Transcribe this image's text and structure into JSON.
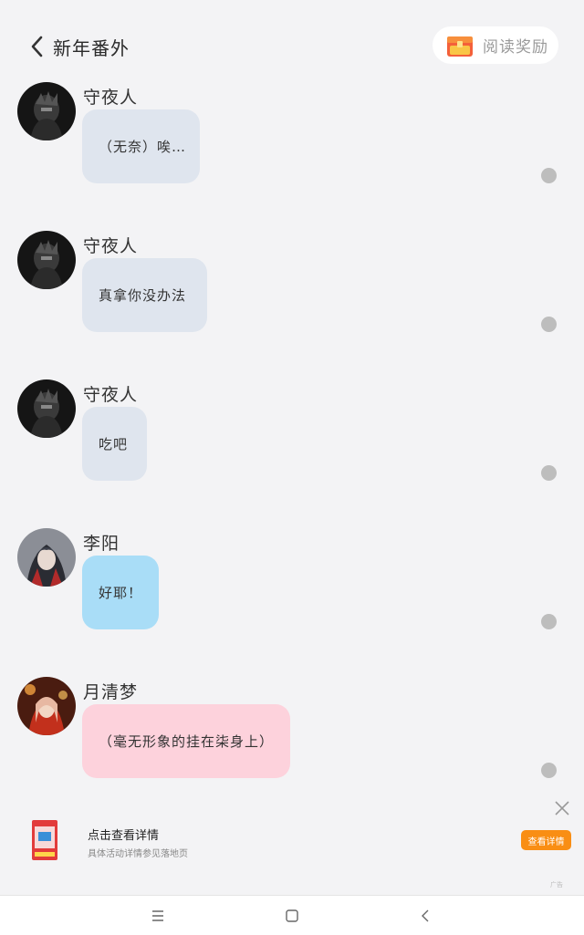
{
  "header": {
    "title": "新年番外",
    "reward_label": "阅读奖励"
  },
  "messages": [
    {
      "name": "守夜人",
      "text": "（无奈）唉…"
    },
    {
      "name": "守夜人",
      "text": "真拿你没办法"
    },
    {
      "name": "守夜人",
      "text": "吃吧"
    },
    {
      "name": "李阳",
      "text": "好耶！"
    },
    {
      "name": "月清梦",
      "text": "（毫无形象的挂在柒身上）"
    }
  ],
  "ad": {
    "title": "点击查看详情",
    "subtitle": "具体活动详情参见落地页",
    "cta": "查看详情",
    "mark": "广告"
  },
  "colors": {
    "bubble_gray": "#dfe5ee",
    "bubble_blue": "#a9ddf7",
    "bubble_pink": "#fdd2dc",
    "cta_orange": "#f98e14",
    "background": "#f3f3f5"
  }
}
